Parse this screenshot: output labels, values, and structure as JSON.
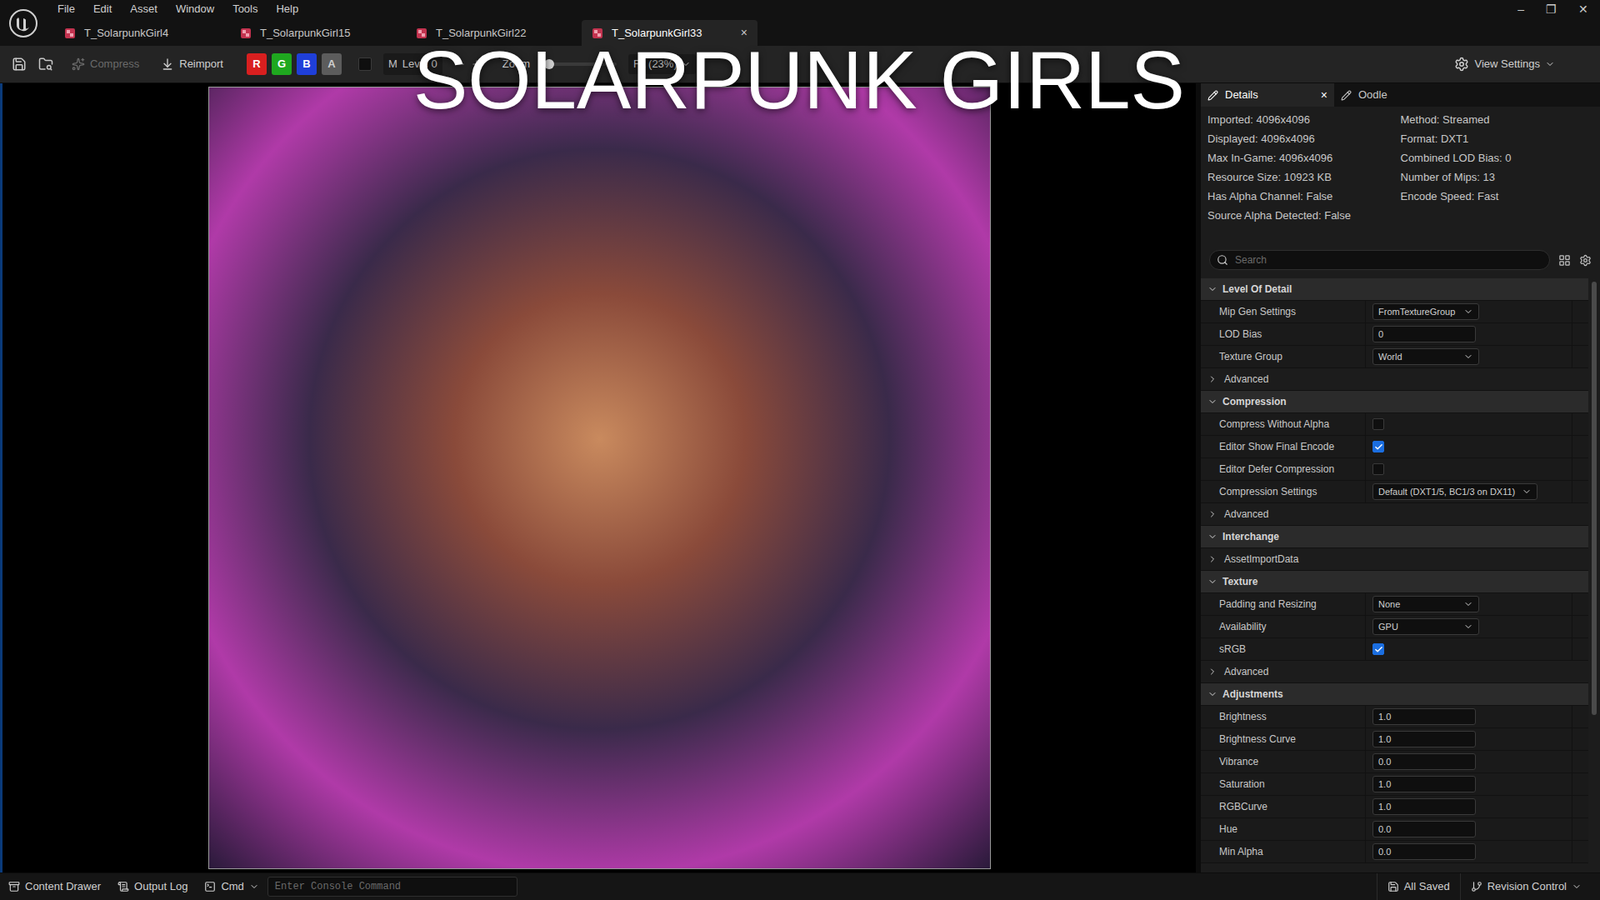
{
  "title_overlay": "SOLARPUNK GIRLS",
  "menu": [
    "File",
    "Edit",
    "Asset",
    "Window",
    "Tools",
    "Help"
  ],
  "window_controls": [
    "–",
    "❐",
    "✕"
  ],
  "tabs": [
    {
      "label": "T_SolarpunkGirl4",
      "selected": false
    },
    {
      "label": "T_SolarpunkGirl15",
      "selected": false
    },
    {
      "label": "T_SolarpunkGirl22",
      "selected": false
    },
    {
      "label": "T_SolarpunkGirl33",
      "selected": true
    }
  ],
  "tab_close": "×",
  "toolbar": {
    "compress": {
      "label": "Compress",
      "disabled": true
    },
    "reimport": "Reimport",
    "channels": [
      {
        "label": "R",
        "on": true,
        "color": "#d91f1f"
      },
      {
        "label": "G",
        "on": true,
        "color": "#1fa81f"
      },
      {
        "label": "B",
        "on": true,
        "color": "#1f3fd9"
      },
      {
        "label": "A",
        "on": false,
        "color": "#5c5c5c"
      }
    ],
    "mip_label": "M",
    "mip_value": "Level 0",
    "zoom_label": "Zoom",
    "zoom_level": 0.1,
    "fit": "Fit (23%)",
    "view_settings": "View Settings"
  },
  "details": {
    "tabs": [
      {
        "label": "Details",
        "selected": true,
        "closable": true
      },
      {
        "label": "Oodle",
        "selected": false,
        "closable": false
      }
    ],
    "info_left": [
      "Imported: 4096x4096",
      "Displayed: 4096x4096",
      "Max In-Game: 4096x4096",
      "Resource Size: 10923 KB",
      "Has Alpha Channel: False",
      "Source Alpha Detected: False"
    ],
    "info_right": [
      "Method: Streamed",
      "Format: DXT1",
      "Combined LOD Bias: 0",
      "Number of Mips: 13",
      "Encode Speed: Fast"
    ],
    "search": {
      "placeholder": "Search"
    },
    "rows": [
      {
        "kind": "section",
        "label": "Level Of Detail",
        "expanded": true
      },
      {
        "kind": "dropdown",
        "label": "Mip Gen Settings",
        "value": "FromTextureGroup"
      },
      {
        "kind": "text",
        "label": "LOD Bias",
        "value": "0"
      },
      {
        "kind": "dropdown",
        "label": "Texture Group",
        "value": "World"
      },
      {
        "kind": "group",
        "label": "Advanced",
        "expanded": false
      },
      {
        "kind": "section",
        "label": "Compression",
        "expanded": true
      },
      {
        "kind": "checkbox",
        "label": "Compress Without Alpha",
        "checked": false
      },
      {
        "kind": "checkbox",
        "label": "Editor Show Final Encode",
        "checked": true
      },
      {
        "kind": "checkbox",
        "label": "Editor Defer Compression",
        "checked": false
      },
      {
        "kind": "dropdown",
        "label": "Compression Settings",
        "value": "Default (DXT1/5, BC1/3 on DX11)"
      },
      {
        "kind": "group",
        "label": "Advanced",
        "expanded": false
      },
      {
        "kind": "section",
        "label": "Interchange",
        "expanded": true
      },
      {
        "kind": "group",
        "label": "AssetImportData",
        "expanded": false
      },
      {
        "kind": "section",
        "label": "Texture",
        "expanded": true
      },
      {
        "kind": "dropdown",
        "label": "Padding and Resizing",
        "value": "None"
      },
      {
        "kind": "dropdown",
        "label": "Availability",
        "value": "GPU"
      },
      {
        "kind": "checkbox",
        "label": "sRGB",
        "checked": true
      },
      {
        "kind": "group",
        "label": "Advanced",
        "expanded": false
      },
      {
        "kind": "section",
        "label": "Adjustments",
        "expanded": true
      },
      {
        "kind": "text",
        "label": "Brightness",
        "value": "1.0"
      },
      {
        "kind": "text",
        "label": "Brightness Curve",
        "value": "1.0"
      },
      {
        "kind": "text",
        "label": "Vibrance",
        "value": "0.0"
      },
      {
        "kind": "text",
        "label": "Saturation",
        "value": "1.0"
      },
      {
        "kind": "text",
        "label": "RGBCurve",
        "value": "1.0"
      },
      {
        "kind": "text",
        "label": "Hue",
        "value": "0.0"
      },
      {
        "kind": "text",
        "label": "Min Alpha",
        "value": "0.0"
      }
    ]
  },
  "status_bar": {
    "content_drawer": "Content Drawer",
    "output_log": "Output Log",
    "cmd": "Cmd",
    "console_placeholder": "Enter Console Command",
    "saved": "All Saved",
    "revision": "Revision Control"
  }
}
